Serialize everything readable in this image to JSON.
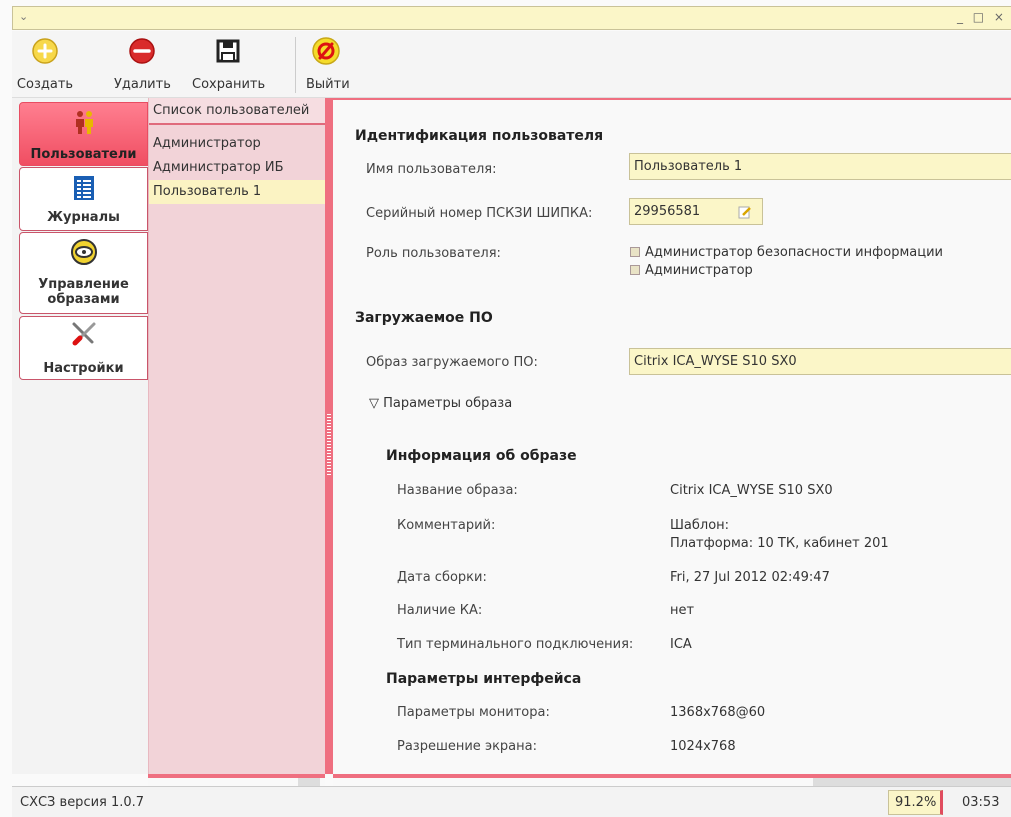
{
  "window": {
    "menu_glyph": "⌄",
    "controls": "_ □ ×"
  },
  "toolbar": {
    "create_label": "Создать",
    "delete_label": "Удалить",
    "save_label": "Сохранить",
    "exit_label": "Выйти"
  },
  "nav": {
    "users_label": "Пользователи",
    "logs_label": "Журналы",
    "images_label": "Управление образами",
    "settings_label": "Настройки"
  },
  "userlist": {
    "header": "Список пользователей",
    "items": [
      "Администратор",
      "Администратор ИБ",
      "Пользователь 1"
    ],
    "selected_index": 2
  },
  "form": {
    "identification_title": "Идентификация пользователя",
    "username_label": "Имя пользователя:",
    "username_value": "Пользователь 1",
    "serial_label": "Серийный номер ПСКЗИ ШИПКА:",
    "serial_value": "29956581",
    "role_label": "Роль пользователя:",
    "role_option_1": "Администратор безопасности информации",
    "role_option_2": "Администратор",
    "boot_title": "Загружаемое ПО",
    "boot_image_label": "Образ загружаемого ПО:",
    "boot_image_value": "Citrix ICA_WYSE S10 SX0",
    "params_toggle": "▽ Параметры образа"
  },
  "image_info": {
    "title": "Информация об образе",
    "name_label": "Название образа:",
    "name_value": "Citrix ICA_WYSE S10 SX0",
    "comment_label": "Комментарий:",
    "comment_line1": "Шаблон:",
    "comment_line2": "Платформа: 10 ТК, кабинет 201",
    "build_date_label": "Дата сборки:",
    "build_date_value": "Fri, 27 Jul 2012 02:49:47",
    "ka_label": "Наличие КА:",
    "ka_value": "нет",
    "conn_type_label": "Тип терминального подключения:",
    "conn_type_value": "ICA"
  },
  "interface_params": {
    "title": "Параметры интерфейса",
    "monitor_label": "Параметры монитора:",
    "monitor_value": "1368x768@60",
    "resolution_label": "Разрешение экрана:",
    "resolution_value": "1024x768"
  },
  "status": {
    "version": "СХСЗ версия 1.0.7",
    "percent": "91.2%",
    "time": "03:53"
  },
  "colors": {
    "accent": "#ef6f80",
    "field_bg": "#fbf6c8",
    "list_bg": "#f2d3d8"
  }
}
